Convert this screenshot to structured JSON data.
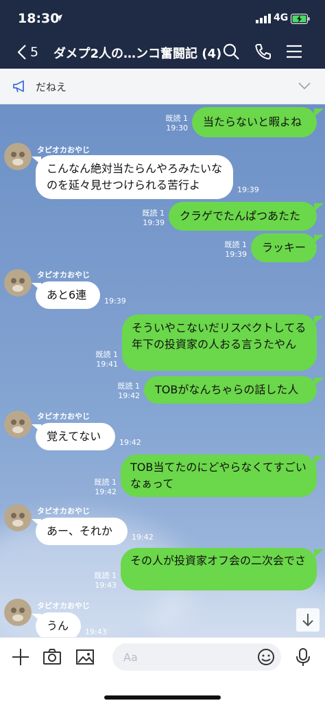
{
  "status": {
    "time": "18:30",
    "network": "4G"
  },
  "nav": {
    "back_count": "5",
    "title": "ダメプ2人の…ンコ奮闘記 (4)"
  },
  "announcement": {
    "text": "だねえ"
  },
  "messages": [
    {
      "type": "out",
      "text": "当たらないと暇よね",
      "read": "既読 1",
      "time": "19:30"
    },
    {
      "type": "in",
      "sender": "タピオカおやじ",
      "text": "こんなん絶対当たらんやろみたいなのを延々見せつけられる苦行よ",
      "time": "19:39"
    },
    {
      "type": "out",
      "text": "クラゲでたんぱつあたた",
      "read": "既読 1",
      "time": "19:39"
    },
    {
      "type": "out",
      "text": "ラッキー",
      "read": "既読 1",
      "time": "19:39"
    },
    {
      "type": "in",
      "sender": "タピオカおやじ",
      "text": "あと6連",
      "time": "19:39"
    },
    {
      "type": "out",
      "text": "そういやこないだリスペクトしてる年下の投資家の人おる言うたやん",
      "read": "既読 1",
      "time": "19:41"
    },
    {
      "type": "out",
      "text": "TOBがなんちゃらの話した人",
      "read": "既読 1",
      "time": "19:42"
    },
    {
      "type": "in",
      "sender": "タピオカおやじ",
      "text": "覚えてない",
      "time": "19:42"
    },
    {
      "type": "out",
      "text": "TOB当てたのにどやらなくてすごいなぁって",
      "read": "既読 1",
      "time": "19:42"
    },
    {
      "type": "in",
      "sender": "タピオカおやじ",
      "text": "あー、それか",
      "time": "19:42"
    },
    {
      "type": "out",
      "text": "その人が投資家オフ会の二次会でさ",
      "read": "既読 1",
      "time": "19:43"
    },
    {
      "type": "in",
      "sender": "タピオカおやじ",
      "text": "うん",
      "time": "19:43"
    }
  ],
  "input": {
    "placeholder": "Aa"
  },
  "colors": {
    "header_bg": "#1f2b45",
    "out_bubble": "#6bd74a",
    "in_bubble": "#ffffff",
    "chat_bg": "#7b9ccd"
  }
}
